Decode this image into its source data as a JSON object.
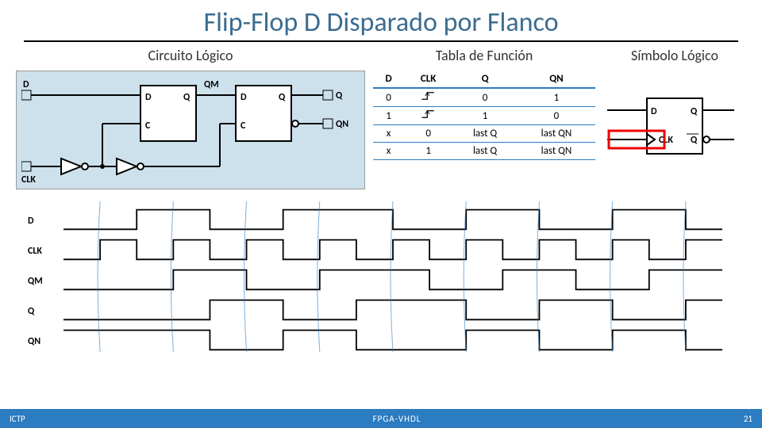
{
  "title": "Flip-Flop D Disparado por Flanco",
  "headings": {
    "circuit": "Circuito Lógico",
    "table": "Tabla de Función",
    "symbol": "Símbolo Lógico"
  },
  "circuit_labels": {
    "d": "D",
    "clk": "CLK",
    "qm": "QM",
    "q": "Q",
    "qn": "QN",
    "ff_d": "D",
    "ff_c": "C",
    "ff_q": "Q"
  },
  "truth_table": {
    "headers": [
      "D",
      "CLK",
      "Q",
      "QN"
    ],
    "rows": [
      {
        "d": "0",
        "clk": "rising",
        "q": "0",
        "qn": "1"
      },
      {
        "d": "1",
        "clk": "rising",
        "q": "1",
        "qn": "0"
      },
      {
        "d": "x",
        "clk": "0",
        "q": "last Q",
        "qn": "last QN"
      },
      {
        "d": "x",
        "clk": "1",
        "q": "last Q",
        "qn": "last QN"
      }
    ]
  },
  "symbol_labels": {
    "d": "D",
    "clk": "CLK",
    "q": "Q"
  },
  "timing_signals": [
    "D",
    "CLK",
    "QM",
    "Q",
    "QN"
  ],
  "footer": {
    "left": "ICTP",
    "center": "FPGA-VHDL",
    "right": "21"
  }
}
